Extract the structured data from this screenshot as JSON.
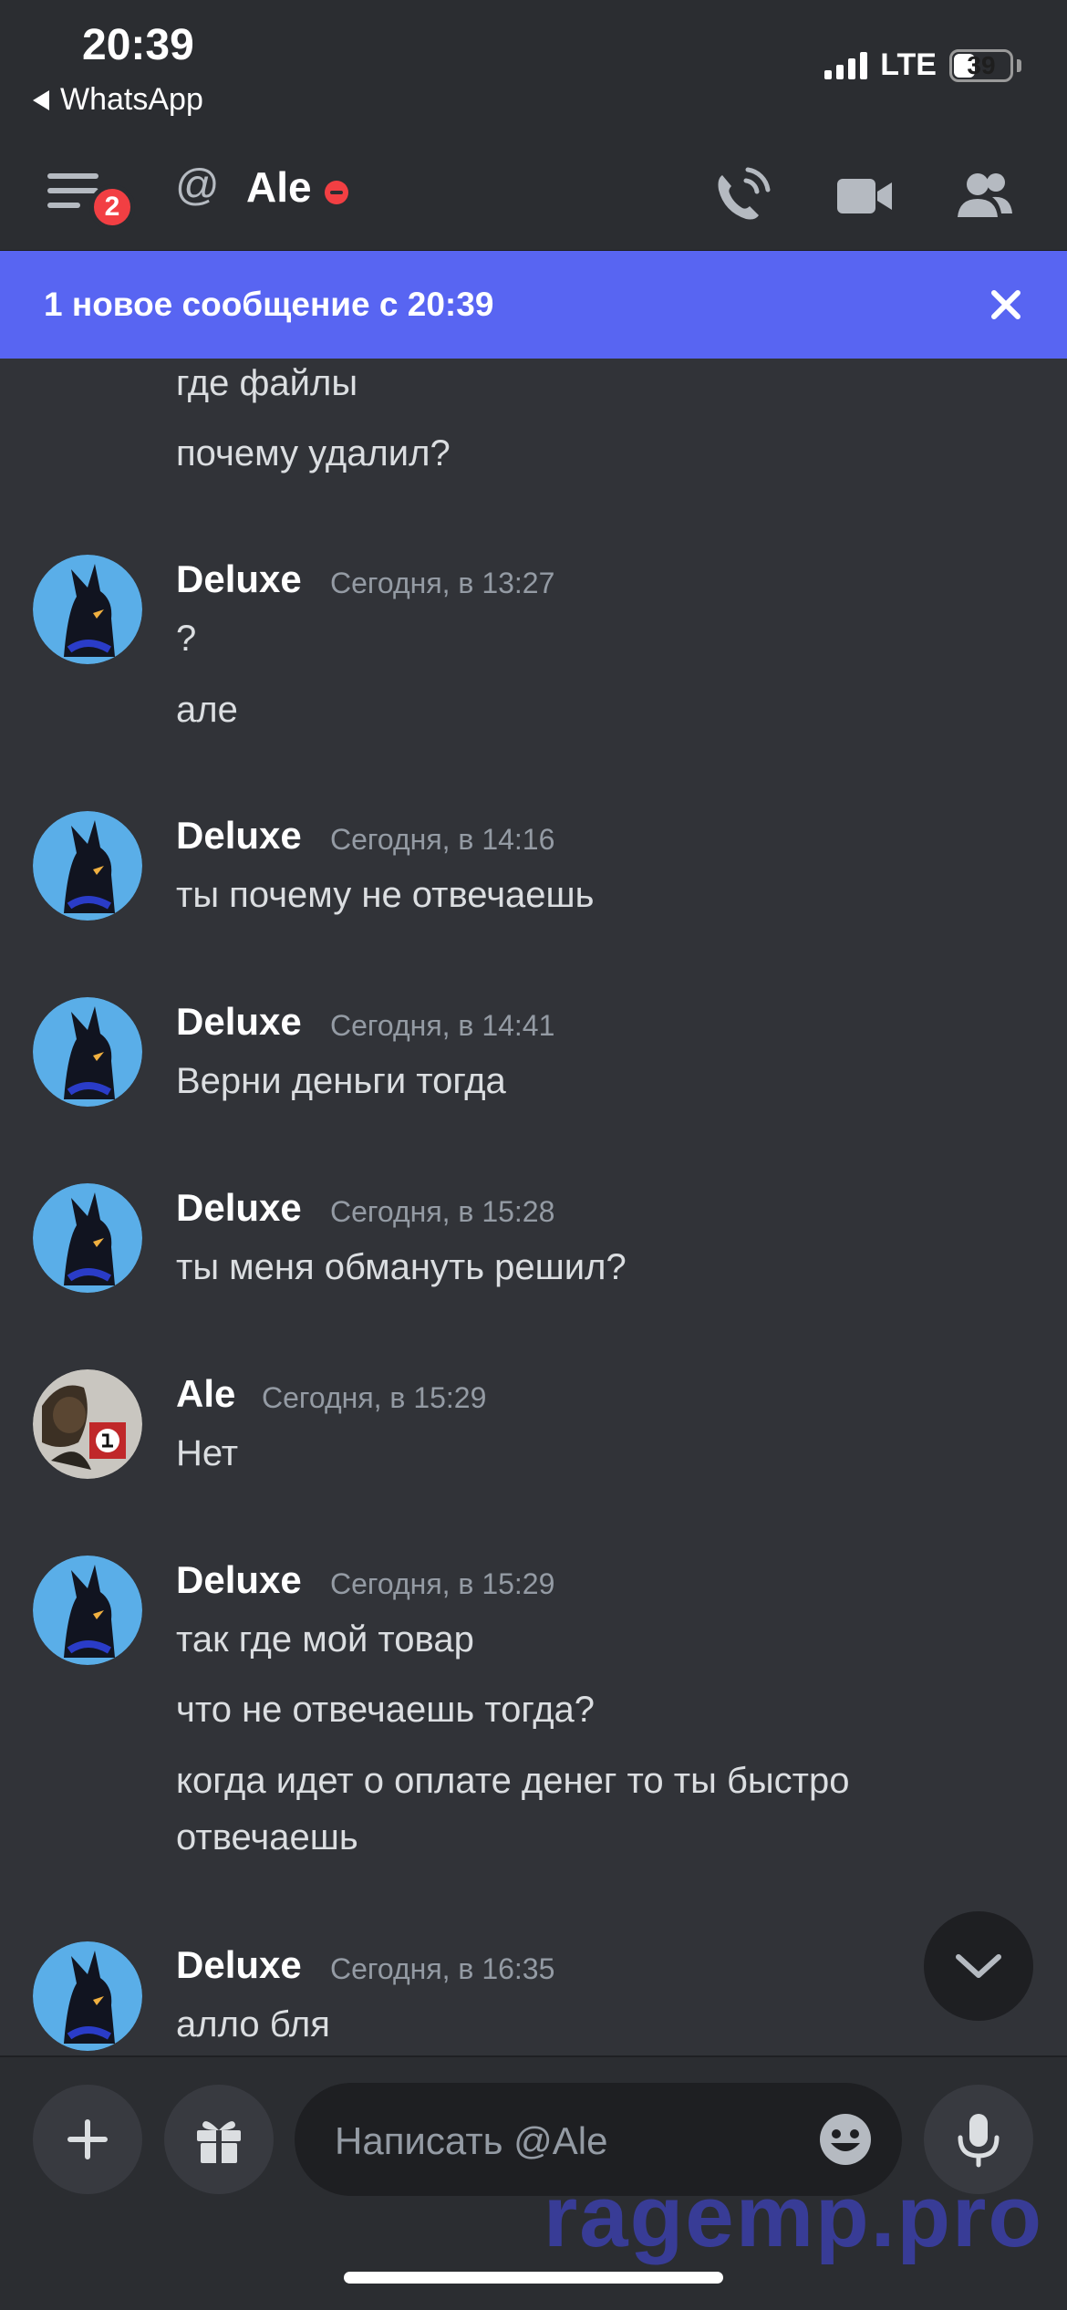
{
  "status_bar": {
    "time": "20:39",
    "back_app": "WhatsApp",
    "network": "LTE",
    "battery": "39",
    "battery_level": 0.39
  },
  "header": {
    "menu_badge": "2",
    "at_symbol": "@",
    "channel_name": "Ale",
    "user_status": "dnd",
    "status_color": "#f23f43"
  },
  "banner": {
    "text": "1 новое сообщение с 20:39",
    "color": "#5865f2"
  },
  "messages": {
    "cont_1": "где файлы",
    "cont_2": "почему удалил?",
    "g1": {
      "author": "Deluxe",
      "time": "Сегодня, в 13:27",
      "lines": [
        "?",
        "але"
      ]
    },
    "g2": {
      "author": "Deluxe",
      "time": "Сегодня, в 14:16",
      "lines": [
        "ты почему не отвечаешь"
      ]
    },
    "g3": {
      "author": "Deluxe",
      "time": "Сегодня, в 14:41",
      "lines": [
        "Верни деньги тогда"
      ]
    },
    "g4": {
      "author": "Deluxe",
      "time": "Сегодня, в 15:28",
      "lines": [
        "ты меня обмануть решил?"
      ]
    },
    "g5": {
      "author": "Ale",
      "time": "Сегодня, в 15:29",
      "lines": [
        "Нет"
      ]
    },
    "g6": {
      "author": "Deluxe",
      "time": "Сегодня, в 15:29",
      "lines": [
        "так где мой товар",
        "что не отвечаешь тогда?",
        "когда идет о оплате денег то ты быстро",
        "отвечаешь"
      ]
    },
    "g7": {
      "author": "Deluxe",
      "time": "Сегодня, в 16:35",
      "lines": [
        "алло бля"
      ]
    }
  },
  "composer": {
    "placeholder": "Написать @Ale",
    "watermark": "ragemp.pro"
  },
  "icons": [
    "menu-icon",
    "at-icon",
    "voice-call-icon",
    "video-call-icon",
    "members-icon",
    "close-icon",
    "chevron-down-icon",
    "plus-icon",
    "gift-icon",
    "emoji-icon",
    "microphone-icon"
  ]
}
